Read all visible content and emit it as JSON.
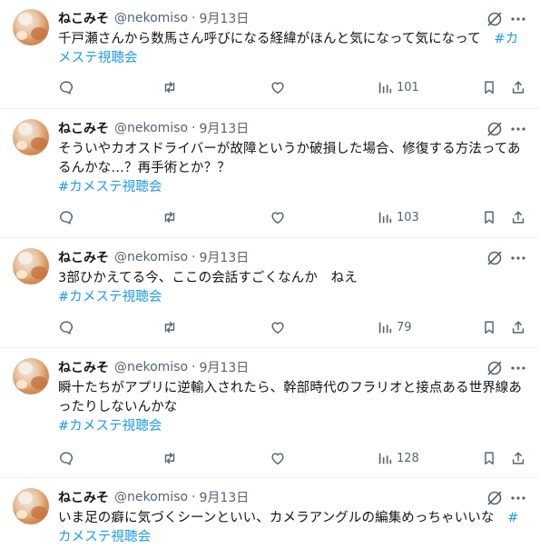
{
  "colors": {
    "text": "#0f1419",
    "muted": "#536471",
    "hashtag": "#1d9bf0",
    "divider": "#eff3f4"
  },
  "icons": {
    "grok": "grok-icon",
    "more": "more-icon",
    "reply": "reply-icon",
    "retweet": "retweet-icon",
    "like": "like-icon",
    "views": "views-icon",
    "bookmark": "bookmark-icon",
    "share": "share-icon"
  },
  "tweets": [
    {
      "name": "ねこみそ",
      "handle": "@nekomiso",
      "sep": "·",
      "date": "9月13日",
      "text": "千戸瀬さんから数馬さん呼びになる経緯がほんと気になって気になって　",
      "hashtag": "#カメステ視聴会",
      "views": "101"
    },
    {
      "name": "ねこみそ",
      "handle": "@nekomiso",
      "sep": "·",
      "date": "9月13日",
      "text": "そういやカオスドライバーが故障というか破損した場合、修復する方法ってあるんかな…？再手術とか？？",
      "hashtag": "#カメステ視聴会",
      "views": "103"
    },
    {
      "name": "ねこみそ",
      "handle": "@nekomiso",
      "sep": "·",
      "date": "9月13日",
      "text": "3部ひかえてる今、ここの会話すごくなんか　ねえ",
      "hashtag": "#カメステ視聴会",
      "views": "79"
    },
    {
      "name": "ねこみそ",
      "handle": "@nekomiso",
      "sep": "·",
      "date": "9月13日",
      "text": "瞬十たちがアプリに逆輸入されたら、幹部時代のフラリオと接点ある世界線あったりしないんかな",
      "hashtag": "#カメステ視聴会",
      "views": "128"
    },
    {
      "name": "ねこみそ",
      "handle": "@nekomiso",
      "sep": "·",
      "date": "9月13日",
      "text": "いま足の癖に気づくシーンといい、カメラアングルの編集めっちゃいいな　",
      "hashtag": "#カメステ視聴会",
      "views": ""
    }
  ]
}
